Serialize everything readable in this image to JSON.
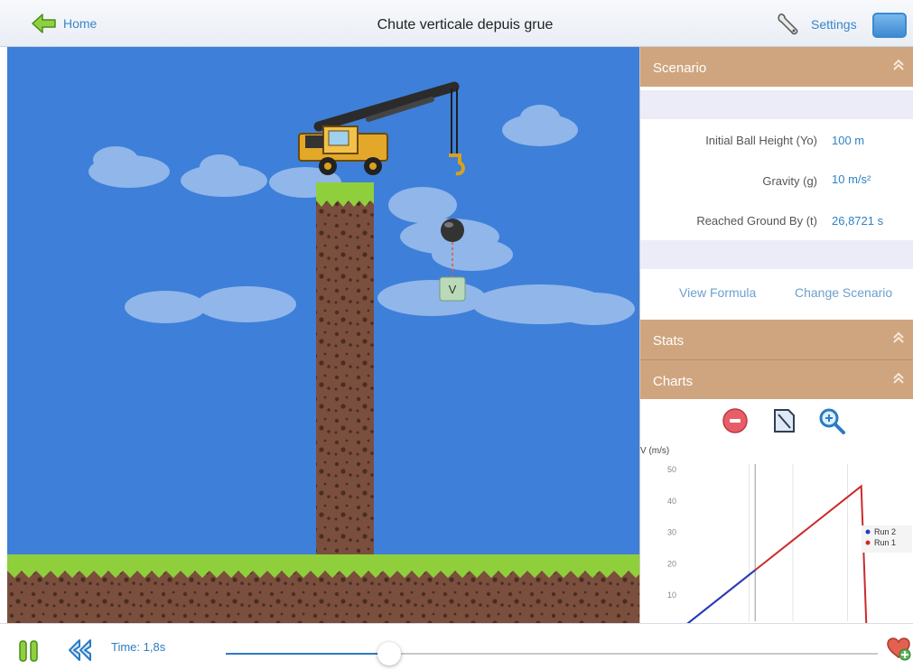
{
  "header": {
    "home_label": "Home",
    "title": "Chute verticale depuis grue",
    "settings_label": "Settings"
  },
  "scene": {
    "velocity_marker_label": "V"
  },
  "panel": {
    "scenario": {
      "title": "Scenario",
      "rows": [
        {
          "label": "Initial Ball Height (Yo)",
          "value": "100 m"
        },
        {
          "label": "Gravity (g)",
          "value": "10 m/s²"
        },
        {
          "label": "Reached Ground By (t)",
          "value": "26,8721 s"
        }
      ],
      "view_formula_label": "View Formula",
      "change_scenario_label": "Change Scenario"
    },
    "stats": {
      "title": "Stats"
    },
    "charts": {
      "title": "Charts"
    }
  },
  "chart_data": {
    "type": "line",
    "ylabel": "V (m/s)",
    "ylim": [
      0,
      50
    ],
    "yticks": [
      0,
      10,
      20,
      30,
      40,
      50
    ],
    "legend_position": "top-right",
    "series": [
      {
        "name": "Run 2",
        "color": "#1f3fbf",
        "points": [
          [
            0,
            0
          ],
          [
            1.8,
            18
          ]
        ]
      },
      {
        "name": "Run 1",
        "color": "#cc2a2a",
        "points": [
          [
            0,
            0
          ],
          [
            1.8,
            18
          ],
          [
            4.47,
            44.7
          ],
          [
            4.6,
            0
          ]
        ]
      }
    ]
  },
  "controls": {
    "time_label": "Time: 1,8s",
    "progress": 0.25
  },
  "colors": {
    "accent": "#2f7bc0",
    "section_header": "#cfa57f",
    "sky": "#3e7fd9"
  }
}
